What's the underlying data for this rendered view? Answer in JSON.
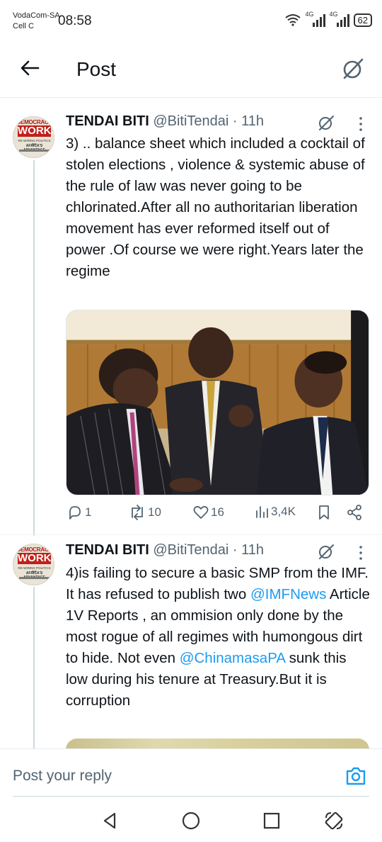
{
  "status_bar": {
    "carrier_primary": "VodaCom-SA",
    "carrier_secondary": "Cell C",
    "time": "08:58",
    "network1": "4G",
    "network2": "4G",
    "battery": "62"
  },
  "header": {
    "title": "Post",
    "back_icon": "arrow-left-icon",
    "grok_icon": "grok-icon"
  },
  "tweets": [
    {
      "author_name": "TENDAI BITI",
      "author_handle": "@BitiTendai",
      "time_separator": " · ",
      "time": "11h",
      "avatar_text": {
        "line1": "DEMOCRACY",
        "line2": "WORKS",
        "line3": "RE-WIRING POLITICS TO",
        "line4": "AFRICA'S ADVANTAGE"
      },
      "text": "3) .. balance sheet which included a cocktail of stolen elections , violence & systemic abuse of the rule of law was never going to be chlorinated.After all no authoritarian liberation movement has ever reformed itself out of power .Of course we were right.Years later the regime",
      "has_photo": true,
      "actions": {
        "replies": "1",
        "reposts": "10",
        "likes": "16",
        "views": "3,4K"
      }
    },
    {
      "author_name": "TENDAI BITI",
      "author_handle": "@BitiTendai",
      "time_separator": " · ",
      "time": "11h",
      "avatar_text": {
        "line1": "DEMOCRACY",
        "line2": "WORKS",
        "line3": "RE-WIRING POLITICS TO",
        "line4": "AFRICA'S ADVANTAGE"
      },
      "text_parts": {
        "p1": "4)is failing to secure a basic SMP from the IMF. It has refused to publish two ",
        "mention1": "@IMFNews",
        "p2": " Article 1V Reports , an ommision only done by the most rogue of all regimes with humongous dirt to hide. Not even ",
        "mention2": "@ChinamasaPA",
        "p3": " sunk this low during his tenure at Treasury.But it is corruption"
      }
    }
  ],
  "reply": {
    "placeholder": "Post your reply",
    "camera_icon": "camera-icon"
  },
  "nav": {
    "back": "triangle-back-icon",
    "home": "circle-home-icon",
    "recents": "square-recents-icon",
    "rotate": "rotate-icon"
  },
  "colors": {
    "accent": "#1d9bf0",
    "text": "#0f1419",
    "secondary": "#536471"
  }
}
